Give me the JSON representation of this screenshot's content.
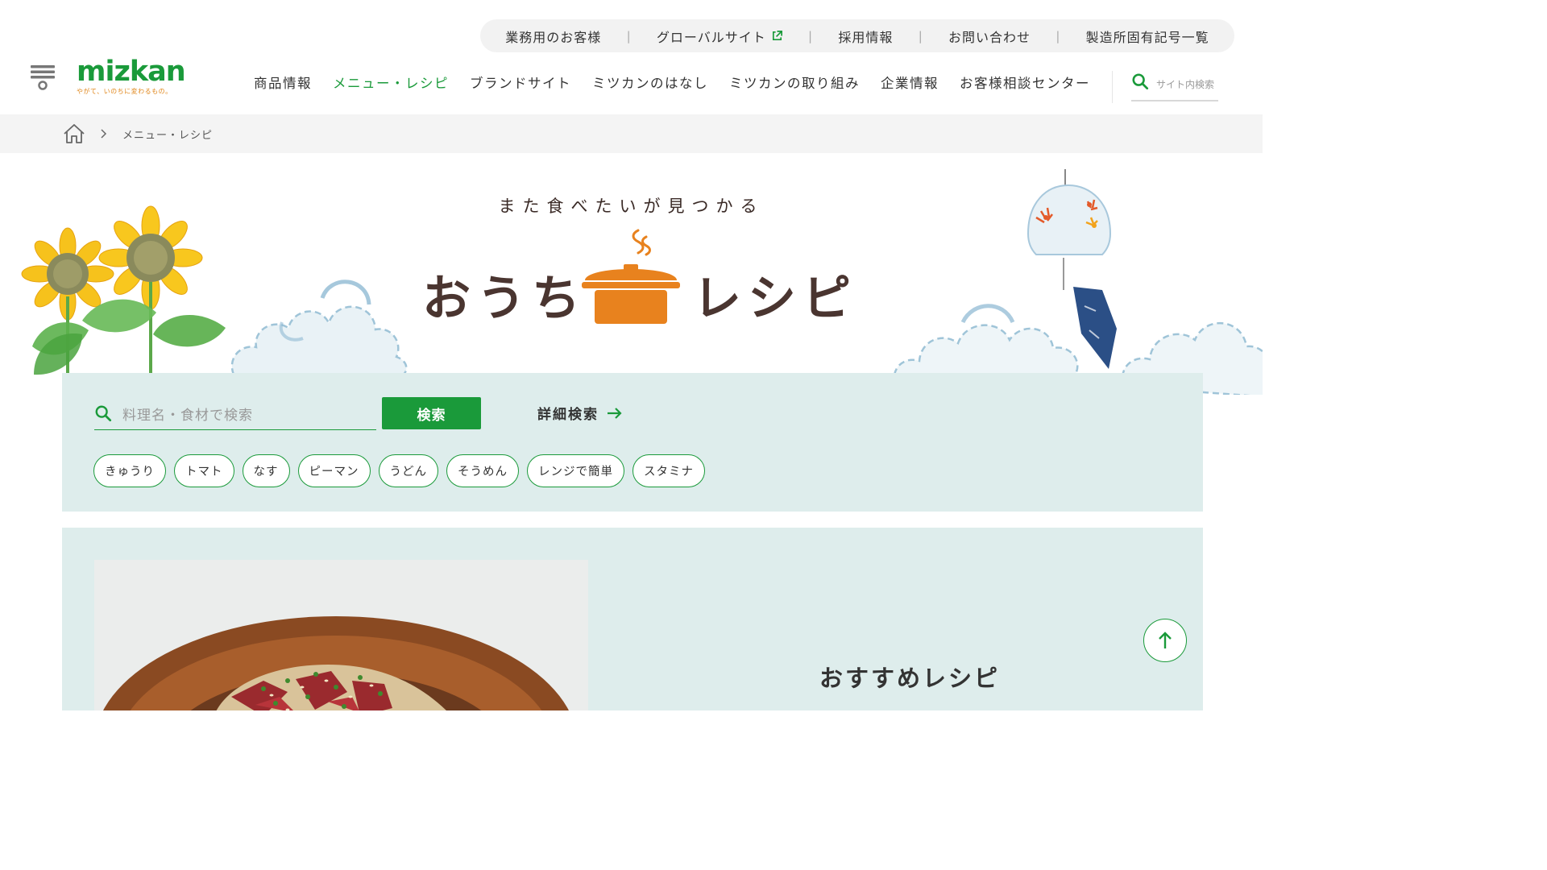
{
  "header": {
    "utility_links": [
      "業務用のお客様",
      "グローバルサイト",
      "採用情報",
      "お問い合わせ",
      "製造所固有記号一覧"
    ],
    "logo": {
      "wordmark": "mizkan",
      "tagline": "やがて、いのちに変わるもの。"
    },
    "nav": [
      "商品情報",
      "メニュー・レシピ",
      "ブランドサイト",
      "ミツカンのはなし",
      "ミツカンの取り組み",
      "企業情報",
      "お客様相談センター"
    ],
    "active_nav": "メニュー・レシピ",
    "site_search_placeholder": "サイト内検索"
  },
  "breadcrumb": {
    "current": "メニュー・レシピ"
  },
  "hero": {
    "subtitle": "また食べたいが見つかる",
    "title_left": "おうち",
    "title_right": "レシピ"
  },
  "search": {
    "placeholder": "料理名・食材で検索",
    "button": "検索",
    "advanced": "詳細検索",
    "tags": [
      "きゅうり",
      "トマト",
      "なす",
      "ピーマン",
      "うどん",
      "そうめん",
      "レンジで簡単",
      "スタミナ"
    ]
  },
  "recommended": {
    "heading": "おすすめレシピ"
  },
  "colors": {
    "brand_green": "#1a9a3a",
    "pot_orange": "#e8821e",
    "panel_bg": "#deedec",
    "title_brown": "#4a3530"
  }
}
